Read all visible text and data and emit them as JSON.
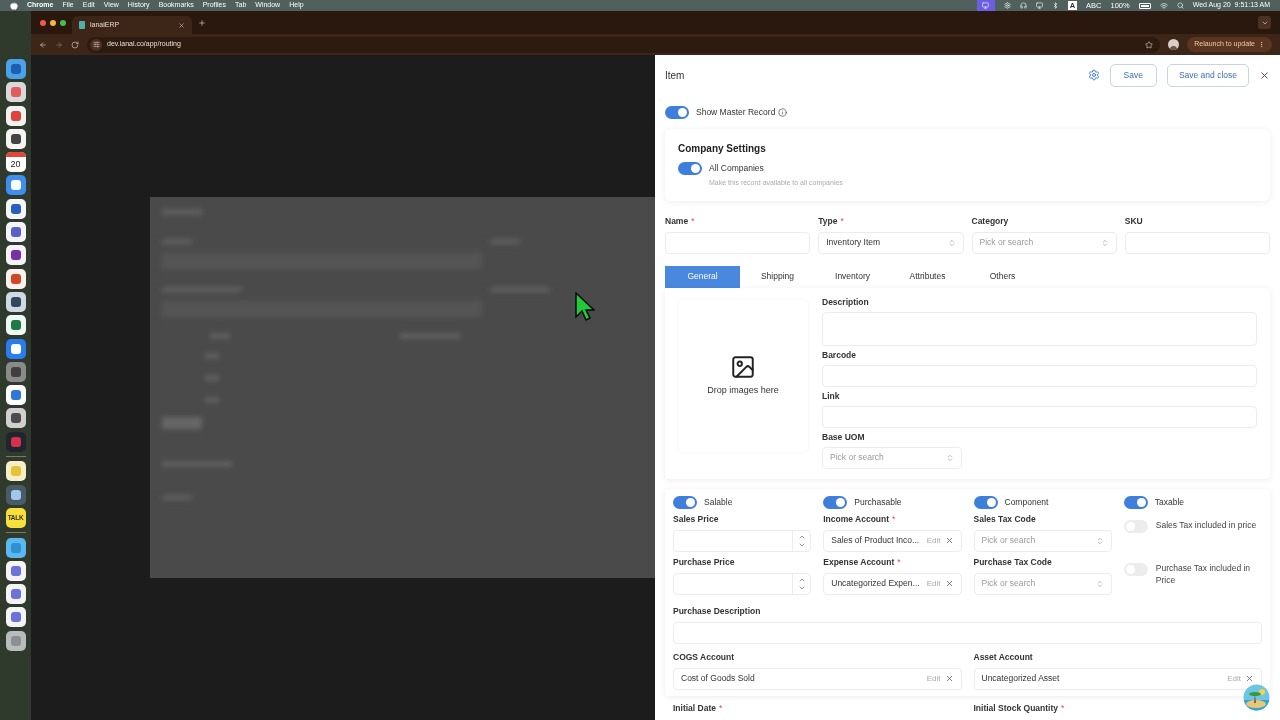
{
  "menu_bar": {
    "app": "Chrome",
    "menus": [
      "File",
      "Edit",
      "View",
      "History",
      "Bookmarks",
      "Profiles",
      "Tab",
      "Window",
      "Help"
    ],
    "input_source": "A",
    "input_label": "ABC",
    "battery": "100%",
    "clock": "Wed Aug 20  9:51:13 AM"
  },
  "browser": {
    "tab": {
      "title": "ianaiERP",
      "selected": true
    },
    "url": "dev.ianai.co/app/routing",
    "relaunch": "Relaunch to update"
  },
  "dock": [
    {
      "kind": "finder"
    },
    {
      "kind": "launchpad"
    },
    {
      "kind": "chrome"
    },
    {
      "kind": "assistant"
    },
    {
      "kind": "calendar",
      "label": "20"
    },
    {
      "kind": "mail"
    },
    {
      "kind": "word"
    },
    {
      "kind": "teams"
    },
    {
      "kind": "onenote"
    },
    {
      "kind": "powerpoint"
    },
    {
      "kind": "preview"
    },
    {
      "kind": "excel"
    },
    {
      "kind": "appstore"
    },
    {
      "kind": "settings"
    },
    {
      "kind": "tasks"
    },
    {
      "kind": "calculator"
    },
    {
      "kind": "recorder"
    },
    {
      "kind": "separator"
    },
    {
      "kind": "notes"
    },
    {
      "kind": "quicktime"
    },
    {
      "kind": "talk",
      "label": "TALK"
    },
    {
      "kind": "separator"
    },
    {
      "kind": "folder"
    },
    {
      "kind": "window"
    },
    {
      "kind": "window"
    },
    {
      "kind": "window"
    },
    {
      "kind": "trash"
    }
  ],
  "drawer": {
    "title": "Item",
    "save": "Save",
    "save_close": "Save and close",
    "required_mark": "*",
    "master": {
      "label": "Show Master Record",
      "on": true
    },
    "company": {
      "title": "Company Settings",
      "toggle": {
        "label": "All Companies",
        "on": true
      },
      "hint": "Make this record available to all companies"
    },
    "fields": [
      {
        "label": "Name",
        "required": true,
        "kind": "input"
      },
      {
        "label": "Type",
        "required": true,
        "kind": "select",
        "value": "Inventory Item"
      },
      {
        "label": "Category",
        "required": false,
        "kind": "select",
        "placeholder": "Pick or search"
      },
      {
        "label": "SKU",
        "required": false,
        "kind": "input"
      }
    ],
    "tabs": [
      {
        "label": "General",
        "selected": true
      },
      {
        "label": "Shipping",
        "selected": false
      },
      {
        "label": "Inventory",
        "selected": false
      },
      {
        "label": "Attributes",
        "selected": false
      },
      {
        "label": "Others",
        "selected": false
      }
    ],
    "image_drop": "Drop images here",
    "general_fields": [
      {
        "label": "Description",
        "kind": "textarea"
      },
      {
        "label": "Barcode",
        "kind": "input"
      },
      {
        "label": "Link",
        "kind": "input"
      },
      {
        "label": "Base UOM",
        "kind": "select",
        "placeholder": "Pick or search"
      }
    ],
    "flags": [
      {
        "label": "Salable",
        "on": true
      },
      {
        "label": "Purchasable",
        "on": true
      },
      {
        "label": "Component",
        "on": true
      },
      {
        "label": "Taxable",
        "on": true
      }
    ],
    "price_rows": [
      [
        {
          "kind": "number",
          "label": "Sales Price",
          "required": false
        },
        {
          "kind": "account",
          "label": "Income Account",
          "required": true,
          "value": "Sales of Product Inco...",
          "edit": "Edit"
        },
        {
          "kind": "select",
          "label": "Sales Tax Code",
          "required": false,
          "placeholder": "Pick or search"
        },
        {
          "kind": "toggle",
          "label": "Sales Tax included in price",
          "on": false
        }
      ],
      [
        {
          "kind": "number",
          "label": "Purchase Price",
          "required": false
        },
        {
          "kind": "account",
          "label": "Expense Account",
          "required": true,
          "value": "Uncategorized Expen...",
          "edit": "Edit"
        },
        {
          "kind": "select",
          "label": "Purchase Tax Code",
          "required": false,
          "placeholder": "Pick or search"
        },
        {
          "kind": "toggle",
          "label": "Purchase Tax included in Price",
          "on": false
        }
      ]
    ],
    "purchase_description": "Purchase Description",
    "accounts": [
      {
        "label": "COGS Account",
        "value": "Cost of Goods Sold",
        "edit": "Edit"
      },
      {
        "label": "Asset Account",
        "value": "Uncategorized Asset",
        "edit": "Edit"
      }
    ],
    "bottom_labels": [
      {
        "label": "Initial Date",
        "required": true
      },
      {
        "label": "Initial Stock Quantity",
        "required": true
      }
    ]
  }
}
